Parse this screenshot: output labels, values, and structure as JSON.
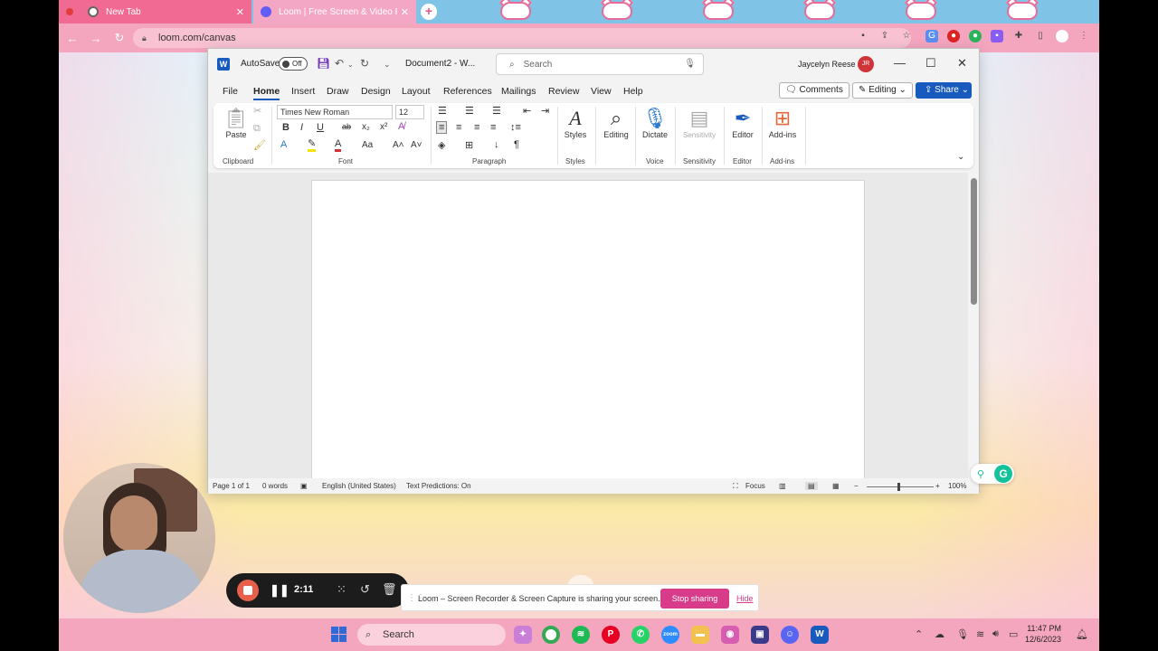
{
  "browser": {
    "tabs": [
      {
        "label": "New Tab",
        "close": "✕"
      },
      {
        "label": "Loom | Free Screen & Video Recording",
        "close": "✕"
      }
    ],
    "new_tab": "+",
    "url": "loom.com/canvas"
  },
  "word": {
    "autosave_label": "AutoSave",
    "autosave_state": "Off",
    "document_name": "Document2 - W...",
    "search_placeholder": "Search",
    "user_name": "Jaycelyn Reese",
    "user_initials": "JR",
    "menu": [
      "File",
      "Home",
      "Insert",
      "Draw",
      "Design",
      "Layout",
      "References",
      "Mailings",
      "Review",
      "View",
      "Help"
    ],
    "comments_label": "Comments",
    "editing_label": "Editing",
    "share_label": "Share",
    "ribbon": {
      "paste": "Paste",
      "font_name": "Times New Roman",
      "font_size": "12",
      "styles": "Styles",
      "editing": "Editing",
      "dictate": "Dictate",
      "sensitivity": "Sensitivity",
      "editor": "Editor",
      "addins": "Add-ins",
      "groups": {
        "clipboard": "Clipboard",
        "font": "Font",
        "paragraph": "Paragraph",
        "styles": "Styles",
        "voice": "Voice",
        "sensitivity": "Sensitivity",
        "editor": "Editor",
        "addins": "Add-ins"
      },
      "font_buttons": [
        "B",
        "I",
        "U",
        "ab",
        "x₂",
        "x²",
        "A",
        "Aa",
        "A˄",
        "A˅"
      ]
    },
    "status": {
      "page": "Page 1 of 1",
      "words": "0 words",
      "language": "English (United States)",
      "predictions": "Text Predictions: On",
      "focus": "Focus",
      "zoom": "100%"
    }
  },
  "loom": {
    "timer": "2:11",
    "share_message": "Loom – Screen Recorder & Screen Capture is sharing your screen.",
    "stop_sharing": "Stop sharing",
    "hide": "Hide"
  },
  "taskbar": {
    "search_placeholder": "Search",
    "time": "11:47 PM",
    "date": "12/6/2023"
  },
  "colors": {
    "word_blue": "#185abd",
    "loom_pink": "#d93b8b",
    "record_orange": "#e8604c",
    "grammarly_green": "#15c39a"
  }
}
